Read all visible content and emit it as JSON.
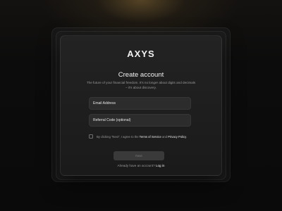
{
  "logo": {
    "text": "AXYS"
  },
  "signup": {
    "title": "Create account",
    "subtitle": "The future of your financial freedom. It's no longer about digits and decimals – it's about discovery.",
    "email_placeholder": "Email Address",
    "referral_placeholder": "Referral Code (optional)",
    "terms": {
      "prefix": "By clicking \"Next\", I agree to the ",
      "terms_link": "Terms of Service",
      "and": " and ",
      "privacy_link": "Privacy Policy",
      "suffix": ".",
      "checked": false
    },
    "next_label": "Next",
    "login_prompt": "Already have an account? ",
    "login_link": "Log in"
  },
  "colors": {
    "background": "#0a0a0a",
    "card": "#1f1f1f",
    "field": "#2c2c2c",
    "button_disabled": "#3a3a3a",
    "glow": "#8a6c36"
  }
}
